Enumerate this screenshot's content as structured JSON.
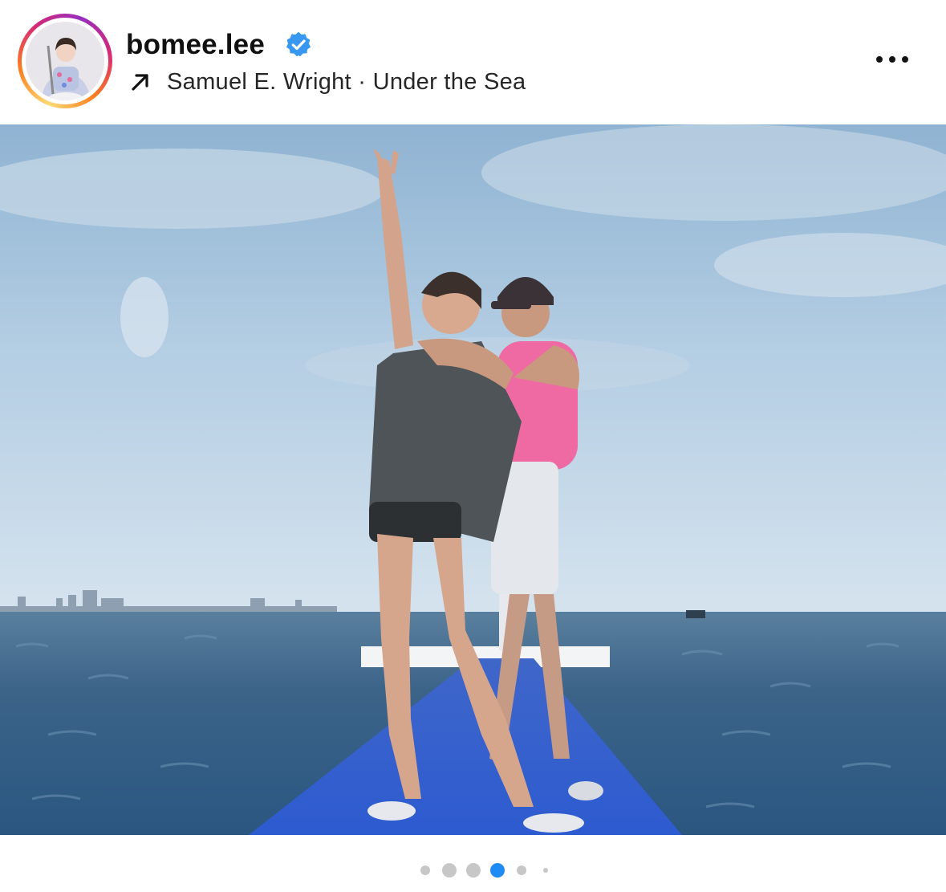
{
  "post": {
    "username": "bomee.lee",
    "verified": true,
    "audio": {
      "icon": "arrow-up-right-icon",
      "text": "Samuel E. Wright · Under the Sea"
    },
    "more_icon": "more-horizontal-icon"
  },
  "media": {
    "type": "video",
    "muted": true,
    "mute_icon": "speaker-muted-icon"
  },
  "carousel": {
    "total": 6,
    "active_index": 3
  },
  "colors": {
    "accent_blue": "#1f8cf5",
    "verified_blue": "#3897f0",
    "story_ring": [
      "#feda75",
      "#fa7e1e",
      "#d62976",
      "#962fbf"
    ]
  }
}
